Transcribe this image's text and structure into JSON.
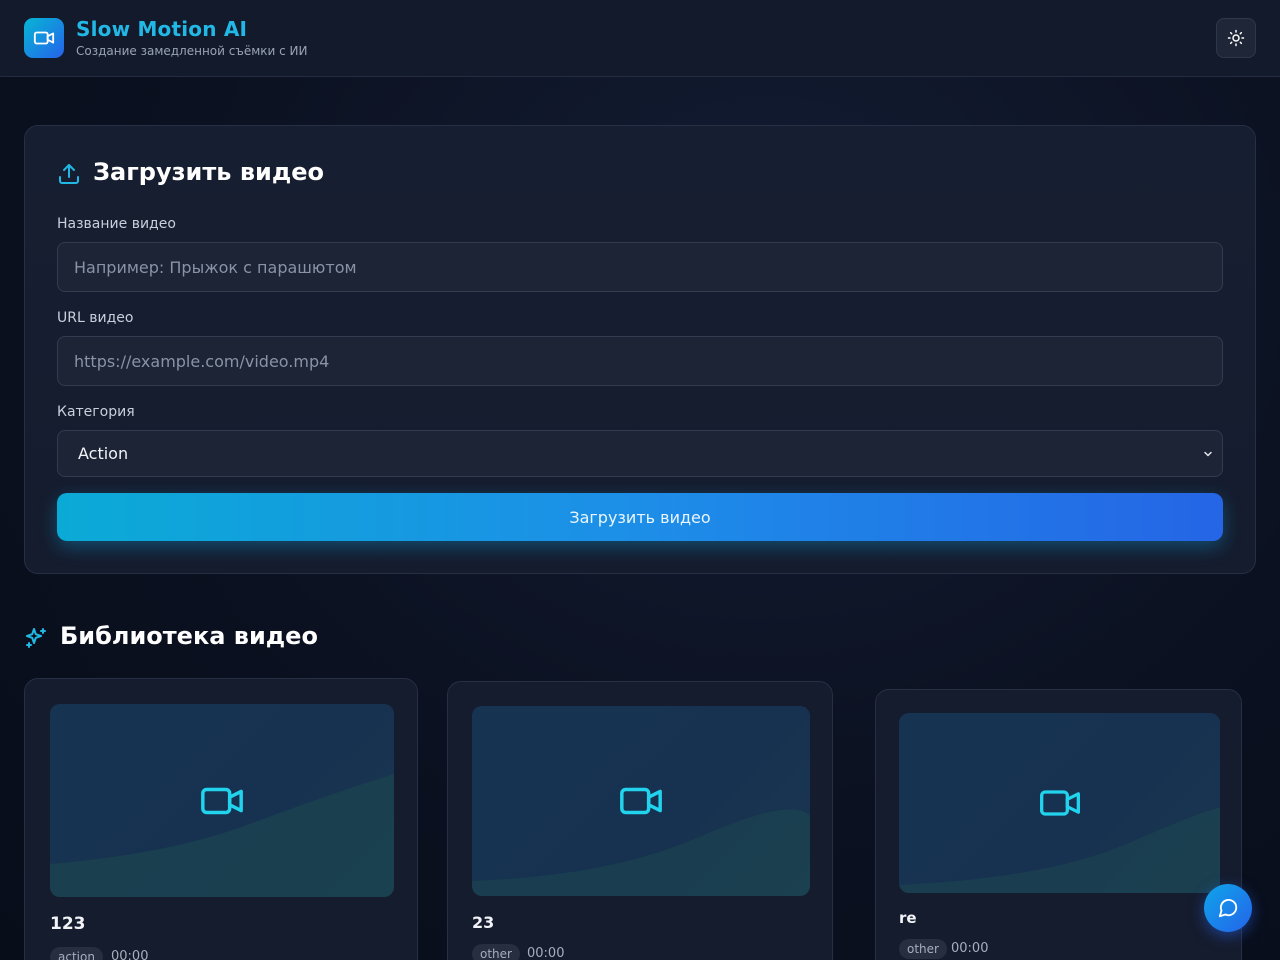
{
  "header": {
    "title": "Slow Motion AI",
    "subtitle": "Создание замедленной съёмки с ИИ"
  },
  "upload": {
    "title": "Загрузить видео",
    "name_label": "Название видео",
    "name_placeholder": "Например: Прыжок с парашютом",
    "url_label": "URL видео",
    "url_placeholder": "https://example.com/video.mp4",
    "category_label": "Категория",
    "category_value": "Action",
    "submit_label": "Загрузить видео"
  },
  "library": {
    "title": "Библиотека видео",
    "videos": [
      {
        "title": "123",
        "category": "action",
        "duration": "00:00"
      },
      {
        "title": "23",
        "category": "other",
        "duration": "00:00"
      },
      {
        "title": "re",
        "category": "other",
        "duration": "00:00"
      }
    ]
  },
  "colors": {
    "accent": "#22b8e6",
    "gradient_start": "#06b6d4",
    "gradient_end": "#2563eb",
    "icon_cyan": "#22d3ee"
  },
  "icons": {
    "logo": "video-camera-icon",
    "theme": "sun-icon",
    "upload": "upload-icon",
    "library": "sparkles-icon",
    "thumbnail": "video-camera-icon",
    "chat": "chat-bubble-icon"
  }
}
